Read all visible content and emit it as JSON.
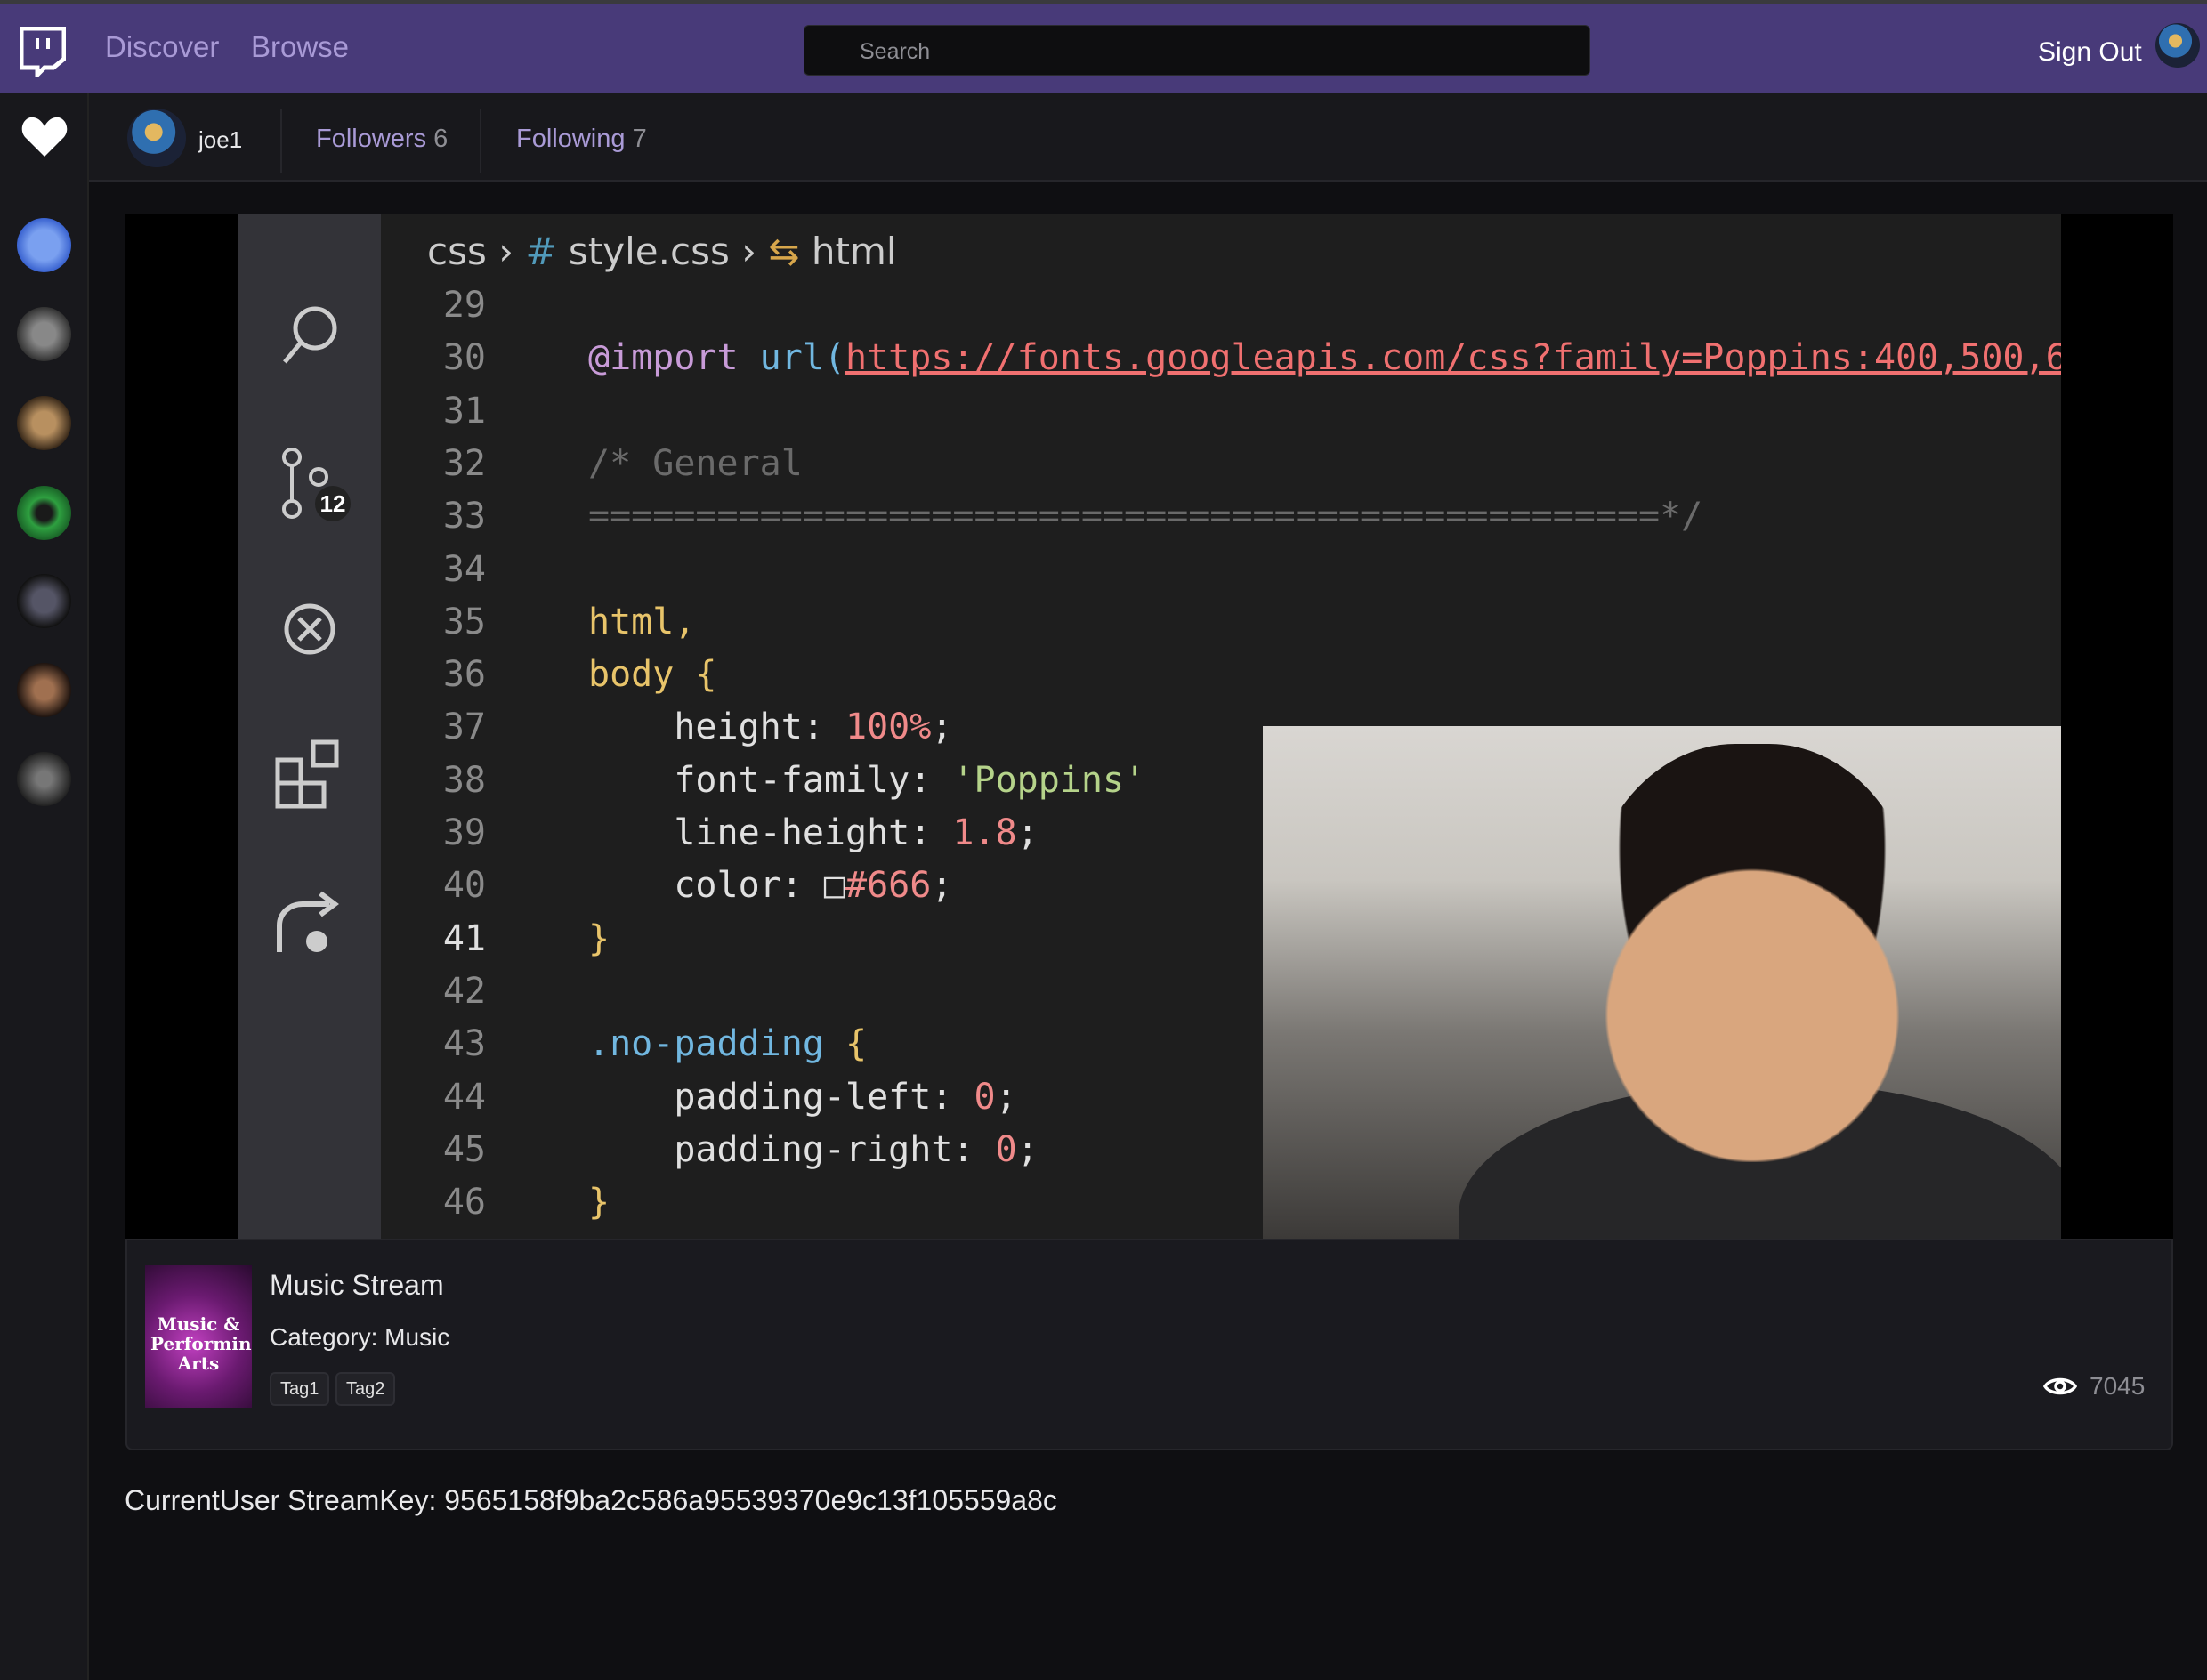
{
  "header": {
    "nav": [
      "Discover",
      "Browse"
    ],
    "search_placeholder": "Search",
    "sign_out": "Sign Out",
    "brand_color": "#483a79"
  },
  "profile": {
    "username": "joe1",
    "followers_label": "Followers",
    "followers_count": "6",
    "following_label": "Following",
    "following_count": "7"
  },
  "sidebar": {
    "avatars": [
      "channel-1",
      "channel-2",
      "channel-3",
      "channel-4",
      "channel-5",
      "channel-6",
      "channel-7"
    ]
  },
  "video": {
    "breadcrumb": [
      "css",
      "#",
      "style.css",
      "html"
    ],
    "scm_badge": "12",
    "line_numbers": [
      "29",
      "30",
      "31",
      "32",
      "33",
      "34",
      "35",
      "36",
      "37",
      "38",
      "39",
      "40",
      "41",
      "42",
      "43",
      "44",
      "45",
      "46"
    ]
  },
  "stream": {
    "title": "Music Stream",
    "category": "Category: Music",
    "tags": [
      "Tag1",
      "Tag2"
    ],
    "viewers": "7045",
    "thumbnail_text": "Music & Performing Arts"
  },
  "stream_key": "CurrentUser StreamKey: 9565158f9ba2c586a95539370e9c13f105559a8c"
}
